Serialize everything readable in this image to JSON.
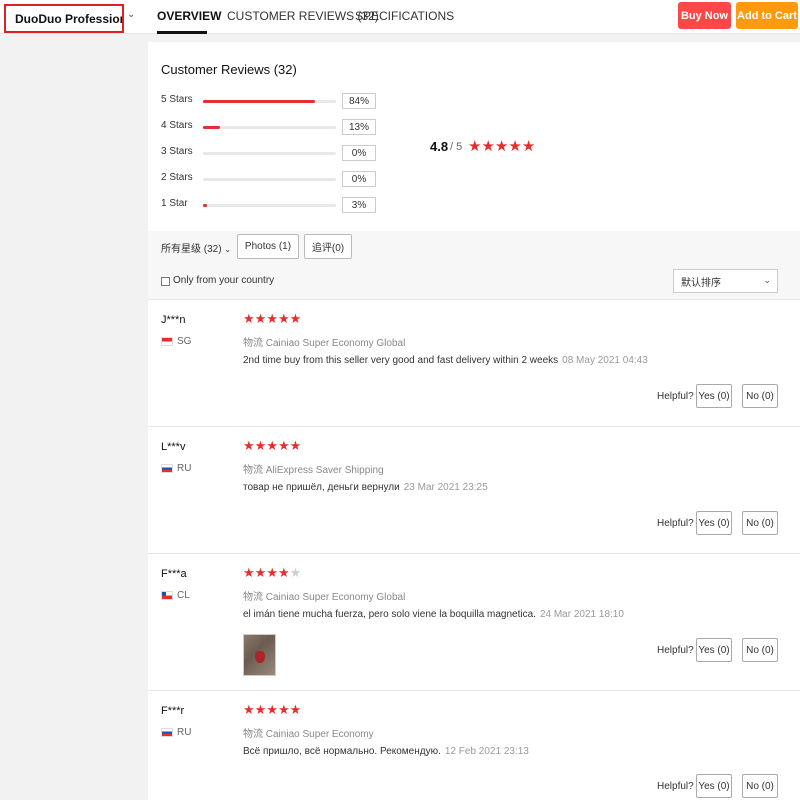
{
  "header": {
    "store_name": "DuoDuo Profession...",
    "tabs": [
      {
        "label": "OVERVIEW",
        "active": true
      },
      {
        "label": "CUSTOMER REVIEWS (32)",
        "active": false
      },
      {
        "label": "SPECIFICATIONS",
        "active": false
      }
    ],
    "buy_now": "Buy Now",
    "add_to_cart": "Add to Cart",
    "colors": {
      "buy": "#ff4747",
      "cart": "#ff9a0c",
      "highlight": "#e02020"
    }
  },
  "reviews_summary": {
    "title": "Customer Reviews (32)",
    "histogram": [
      {
        "label": "5 Stars",
        "percent": 84,
        "percent_text": "84%"
      },
      {
        "label": "4 Stars",
        "percent": 13,
        "percent_text": "13%"
      },
      {
        "label": "3 Stars",
        "percent": 0,
        "percent_text": "0%"
      },
      {
        "label": "2 Stars",
        "percent": 0,
        "percent_text": "0%"
      },
      {
        "label": "1 Star",
        "percent": 3,
        "percent_text": "3%"
      }
    ],
    "average": "4.8",
    "out_of": "/ 5",
    "average_stars": 5
  },
  "filters": {
    "all_ratings": "所有星级 (32)",
    "photos": "Photos (1)",
    "additional": "追评(0)",
    "country_only": "Only from your country",
    "sort": "默认排序"
  },
  "reviews": [
    {
      "user": "J***n",
      "country": "SG",
      "flag": "sg",
      "stars": 5,
      "shipping": "物流 Cainiao Super Economy Global",
      "text": "2nd time buy from this seller very good and fast delivery within 2 weeks",
      "date": "08 May 2021 04:43",
      "has_photo": false,
      "helpful": "Helpful?",
      "yes": "Yes (0)",
      "no": "No (0)"
    },
    {
      "user": "L***v",
      "country": "RU",
      "flag": "ru",
      "stars": 5,
      "shipping": "物流 AliExpress Saver Shipping",
      "text": "товар не пришёл, деньги вернули",
      "date": "23 Mar 2021 23:25",
      "has_photo": false,
      "helpful": "Helpful?",
      "yes": "Yes (0)",
      "no": "No (0)"
    },
    {
      "user": "F***a",
      "country": "CL",
      "flag": "cl",
      "stars": 4,
      "shipping": "物流 Cainiao Super Economy Global",
      "text": "el imán tiene mucha fuerza, pero solo viene la boquilla magnetica.",
      "date": "24 Mar 2021 18:10",
      "has_photo": true,
      "helpful": "Helpful?",
      "yes": "Yes (0)",
      "no": "No (0)"
    },
    {
      "user": "F***r",
      "country": "RU",
      "flag": "ru",
      "stars": 5,
      "shipping": "物流 Cainiao Super Economy",
      "text": "Всё пришло, всё нормально. Рекомендую.",
      "date": "12 Feb 2021 23:13",
      "has_photo": false,
      "helpful": "Helpful?",
      "yes": "Yes (0)",
      "no": "No (0)"
    }
  ]
}
